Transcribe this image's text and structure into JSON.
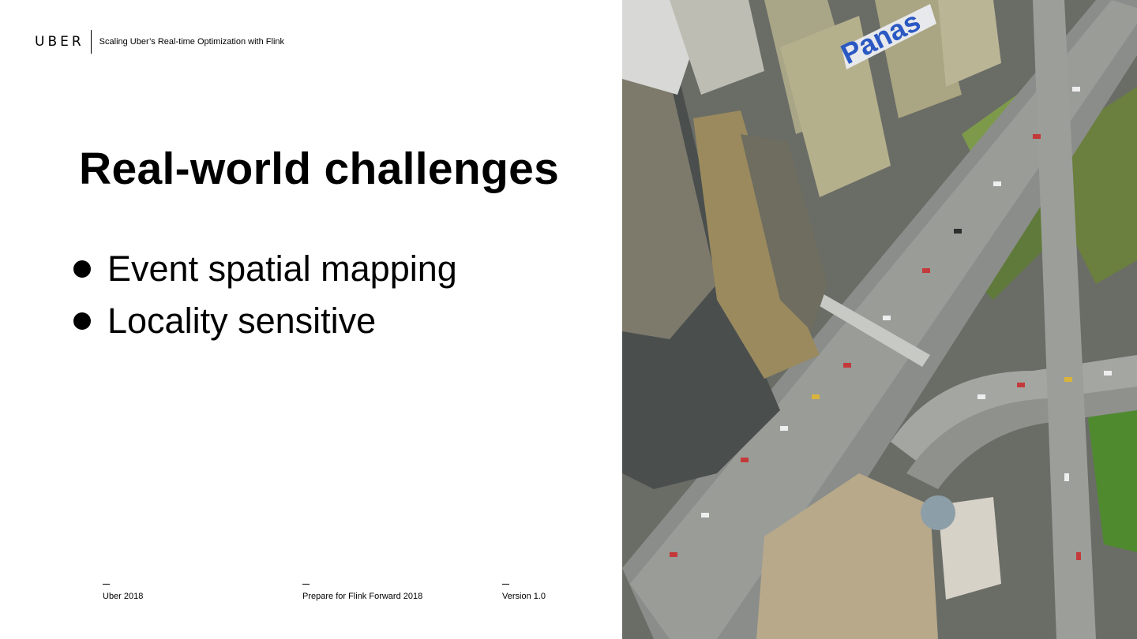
{
  "header": {
    "logo": "UBER",
    "deck_title": "Scaling Uber’s Real-time Optimization with Flink"
  },
  "slide": {
    "title": "Real-world challenges",
    "bullets": [
      "Event spatial mapping",
      "Locality sensitive"
    ]
  },
  "footer": {
    "left": "Uber 2018",
    "center": "Prepare for Flink Forward 2018",
    "right": "Version 1.0"
  },
  "photo": {
    "sign_text": "Panas"
  },
  "colors": {
    "text": "#000000",
    "background": "#ffffff"
  }
}
